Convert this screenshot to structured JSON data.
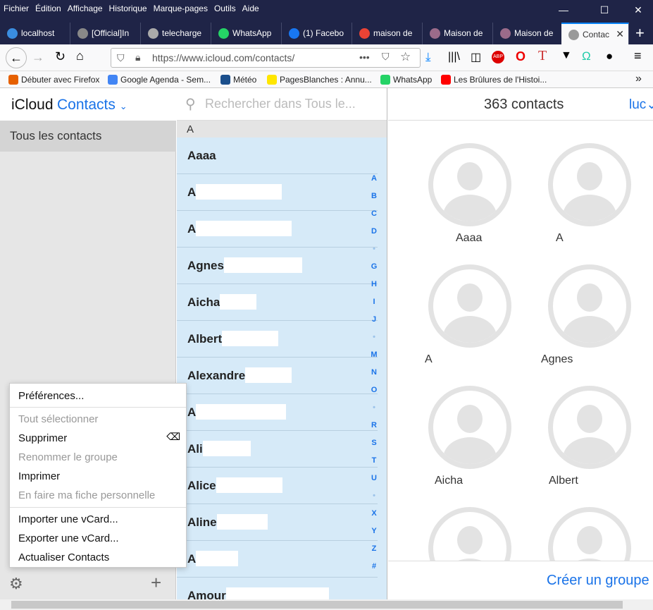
{
  "menubar": [
    "Fichier",
    "Édition",
    "Affichage",
    "Historique",
    "Marque-pages",
    "Outils",
    "Aide"
  ],
  "tabs": [
    {
      "label": "localhost",
      "color": "#3a8de0"
    },
    {
      "label": "[Official]In",
      "color": "#888"
    },
    {
      "label": "telecharge",
      "color": "#aaa"
    },
    {
      "label": "WhatsApp",
      "color": "#25d366"
    },
    {
      "label": "(1) Facebo",
      "color": "#1877f2"
    },
    {
      "label": "maison de",
      "color": "#ea4335"
    },
    {
      "label": "Maison de",
      "color": "#9b6b8a"
    },
    {
      "label": "Maison de",
      "color": "#9b6b8a"
    },
    {
      "label": "Contac",
      "color": "#999"
    }
  ],
  "url": "https://www.icloud.com/contacts/",
  "bookmarks": [
    {
      "label": "Débuter avec Firefox",
      "color": "#e66000"
    },
    {
      "label": "Google Agenda - Sem...",
      "color": "#4285f4"
    },
    {
      "label": "Météo",
      "color": "#1b4f8c"
    },
    {
      "label": "PagesBlanches : Annu...",
      "color": "#ffe600"
    },
    {
      "label": "WhatsApp",
      "color": "#25d366"
    },
    {
      "label": "Les Brûlures de l'Histoi...",
      "color": "#ff0000"
    }
  ],
  "sidebar": {
    "brand": "iCloud",
    "app": "Contacts",
    "group": "Tous les contacts"
  },
  "search": {
    "placeholder": "Rechercher dans Tous le..."
  },
  "section": "A",
  "contacts": [
    "Aaaa",
    "A",
    "A",
    "Agnes",
    "Aicha",
    "Albert",
    "Alexandre",
    "A",
    "Ali",
    "Alice",
    "Aline",
    "A",
    "Amour"
  ],
  "index": [
    "A",
    "B",
    "C",
    "D",
    "•",
    "G",
    "H",
    "I",
    "J",
    "•",
    "M",
    "N",
    "O",
    "•",
    "R",
    "S",
    "T",
    "U",
    "•",
    "X",
    "Y",
    "Z",
    "#"
  ],
  "main": {
    "count": "363 contacts",
    "user": "luc",
    "create_group": "Créer un groupe"
  },
  "cards": [
    "Aaaa",
    "A",
    "A",
    "Agnes",
    "Aicha",
    "Albert"
  ],
  "menu": {
    "items": [
      {
        "label": "Préférences...",
        "disabled": false
      },
      {
        "label": "Tout sélectionner",
        "disabled": true
      },
      {
        "label": "Supprimer",
        "disabled": false
      },
      {
        "label": "Renommer le groupe",
        "disabled": true
      },
      {
        "label": "Imprimer",
        "disabled": false
      },
      {
        "label": "En faire ma fiche personnelle",
        "disabled": true
      },
      {
        "label": "Importer une vCard...",
        "disabled": false
      },
      {
        "label": "Exporter une vCard...",
        "disabled": false
      },
      {
        "label": "Actualiser Contacts",
        "disabled": false
      }
    ]
  }
}
